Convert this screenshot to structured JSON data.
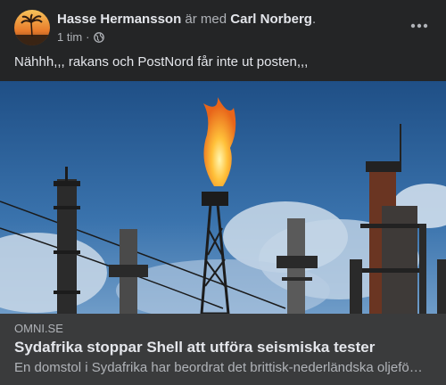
{
  "post": {
    "author": "Hasse Hermansson",
    "with_word": "är med",
    "tagged": "Carl Norberg",
    "tagged_suffix": ".",
    "time": "1 tim",
    "separator": "·",
    "privacy_icon": "globe-icon",
    "more_icon": "more-options-icon",
    "text": "Nähhh,,, rakans och PostNord får inte ut posten,,,"
  },
  "link": {
    "domain": "OMNI.SE",
    "title": "Sydafrika stoppar Shell att utföra seismiska tester",
    "description": "En domstol i Sydafrika har beordrat det brittisk-nederländska oljefö…"
  },
  "colors": {
    "background": "#242526",
    "link_box": "#3a3b3c",
    "primary_text": "#e4e6eb",
    "secondary_text": "#b0b3b8",
    "sky": "#2a5d96",
    "flame": "#f5a623"
  }
}
